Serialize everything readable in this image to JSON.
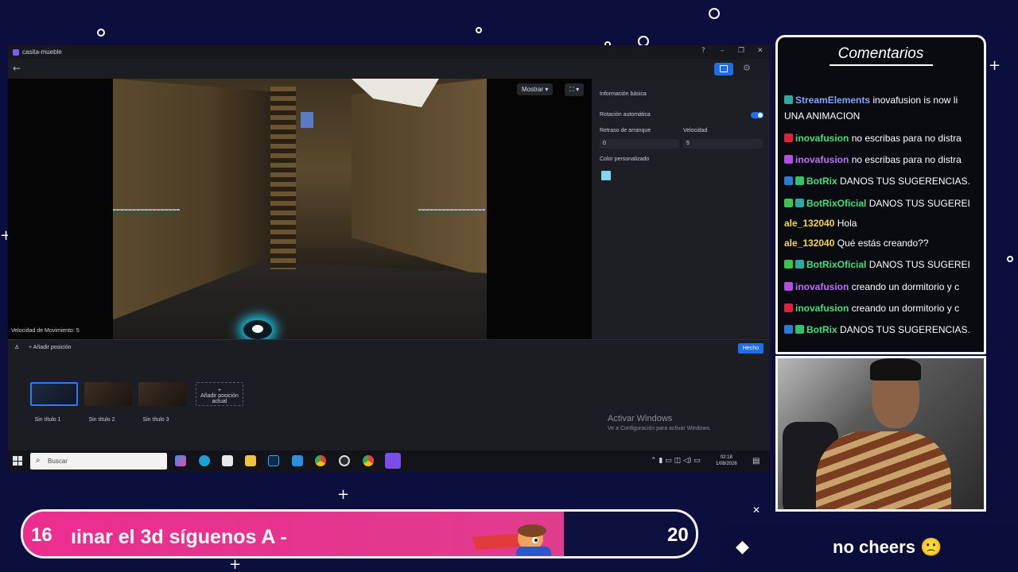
{
  "window": {
    "title": "casita-mueble",
    "back_glyph": "←",
    "controls": [
      "?",
      "–",
      "❐",
      "✕"
    ]
  },
  "viewport": {
    "show_dropdown": "Mostrar ▾",
    "camera_btn": "⛶ ▾",
    "speed_label": "Velocidad de Movimiento: 5"
  },
  "properties": {
    "section_title": "Información básica",
    "auto_rotation": "Rotación automática",
    "auto_rotation_on": true,
    "start_delay_label": "Retraso de arranque",
    "start_delay_value": "0",
    "speed_label": "Velocidad",
    "speed_value": "5",
    "custom_color_label": "Color personalizado",
    "custom_color": "#7fd8ee"
  },
  "positions": {
    "add_label": "Añadir posición",
    "done_label": "Hecho",
    "thumbnails": [
      {
        "label": "Sin título 1",
        "active": true
      },
      {
        "label": "Sin título 2",
        "active": false
      },
      {
        "label": "Sin título 3",
        "active": false
      }
    ],
    "add_current": "Añadir posición actual",
    "add_current_plus": "+"
  },
  "watermark": {
    "line1": "Activar Windows",
    "line2": "Ve a Configuración para activar Windows."
  },
  "taskbar": {
    "search_placeholder": "Buscar",
    "time": "02:18",
    "date": "1/08/2026",
    "apps": [
      "copilot",
      "edge",
      "store",
      "explorer",
      "photoshop",
      "vscode",
      "chrome",
      "obs",
      "chrome-2",
      "twitch-studio"
    ]
  },
  "chat": {
    "title": "Comentarios",
    "messages": [
      {
        "user": "StreamElements",
        "user_color": "#7fa6ff",
        "text": "inovafusion is now li",
        "badges": [
          "#2ea8a0"
        ]
      },
      {
        "user": "",
        "user_color": "#ffffff",
        "text": "UNA ANIMACION",
        "badges": []
      },
      {
        "user": "inovafusion",
        "user_color": "#40e07a",
        "text": "no escribas para no distra",
        "badges": [
          "#e0213b"
        ]
      },
      {
        "user": "inovafusion",
        "user_color": "#c070ff",
        "text": "no escribas para no distra",
        "badges": [
          "#b14de0"
        ]
      },
      {
        "user": "BotRix",
        "user_color": "#40e07a",
        "text": "DANOS TUS SUGERENCIAS.",
        "badges": [
          "#2a7ad8",
          "#2fc36a"
        ]
      },
      {
        "user": "BotRixOficial",
        "user_color": "#40e07a",
        "text": "DANOS TUS SUGEREI",
        "badges": [
          "#38c74d",
          "#2ea8a0"
        ]
      },
      {
        "user": "ale_132040",
        "user_color": "#f2d64a",
        "text": "Hola",
        "badges": []
      },
      {
        "user": "ale_132040",
        "user_color": "#f2d64a",
        "text": "Qué estás creando??",
        "badges": []
      },
      {
        "user": "BotRixOficial",
        "user_color": "#40e07a",
        "text": "DANOS TUS SUGEREI",
        "badges": [
          "#38c74d",
          "#2ea8a0"
        ]
      },
      {
        "user": "inovafusion",
        "user_color": "#c070ff",
        "text": "creando un dormitorio y c",
        "badges": [
          "#b14de0"
        ]
      },
      {
        "user": "inovafusion",
        "user_color": "#40e07a",
        "text": "creando un dormitorio y c",
        "badges": [
          "#e0213b"
        ]
      },
      {
        "user": "BotRix",
        "user_color": "#40e07a",
        "text": "DANOS TUS SUGERENCIAS.",
        "badges": [
          "#2a7ad8",
          "#2fc36a"
        ]
      }
    ]
  },
  "banner": {
    "left_number": "16",
    "ticker": "ıinar el 3d   síguenos  A  -",
    "right_number": "20"
  },
  "cheers": {
    "text": "no cheers 🙁",
    "icon": "diamond-icon"
  },
  "colors": {
    "accent_blue": "#1e6ee6",
    "banner_pink": "#ec2d8f",
    "background": "#0c0f3e"
  }
}
